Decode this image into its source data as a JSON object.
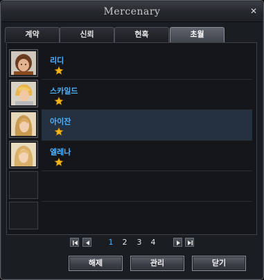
{
  "window": {
    "title": "Mercenary",
    "close_icon": "close-icon"
  },
  "tabs": [
    {
      "label": "계약",
      "active": false
    },
    {
      "label": "신뢰",
      "active": false
    },
    {
      "label": "현혹",
      "active": false
    },
    {
      "label": "초월",
      "active": true
    }
  ],
  "mercenaries": [
    {
      "name": "리디",
      "stars": 1,
      "portrait": "portrait-lidi"
    },
    {
      "name": "스카일드",
      "stars": 1,
      "portrait": "portrait-skyld"
    },
    {
      "name": "아이잔",
      "stars": 1,
      "portrait": "portrait-aizan",
      "selected": true
    },
    {
      "name": "엘레나",
      "stars": 1,
      "portrait": "portrait-elena"
    }
  ],
  "pagination": {
    "pages": [
      "1",
      "2",
      "3",
      "4"
    ],
    "current": "1"
  },
  "buttons": {
    "dismiss": "해제",
    "manage": "관리",
    "close": "닫기"
  },
  "colors": {
    "name_text": "#4fb3ff",
    "selected_row": "#243140",
    "star": "#f2b51c"
  }
}
